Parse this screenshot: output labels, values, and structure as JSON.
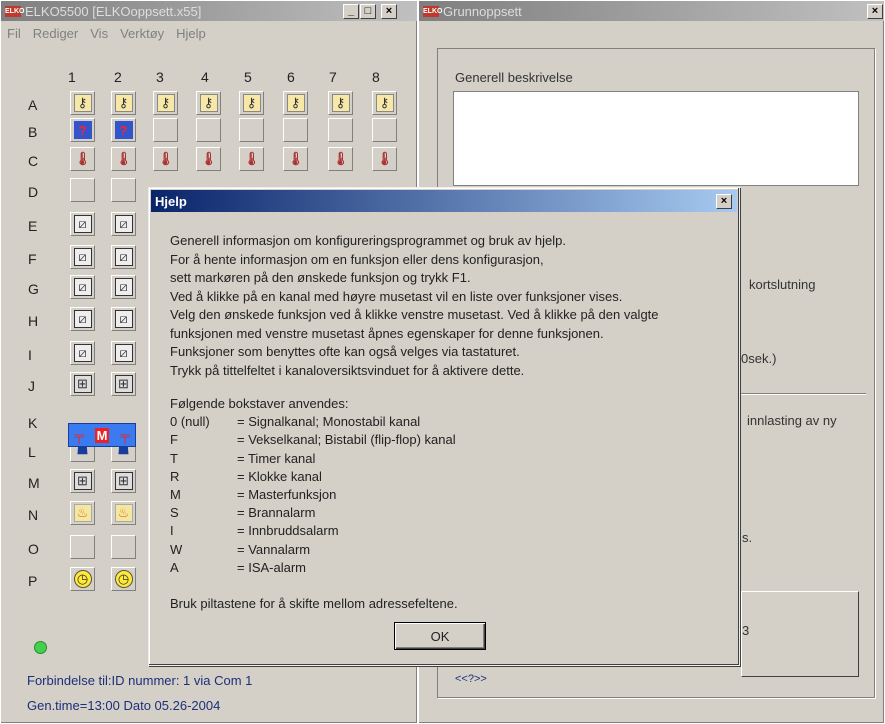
{
  "left_window": {
    "title": "ELKO5500 [ELKOoppsett.x55]",
    "menu": [
      "Fil",
      "Rediger",
      "Vis",
      "Verktøy",
      "Hjelp"
    ],
    "columns": [
      "1",
      "2",
      "3",
      "4",
      "5",
      "6",
      "7",
      "8"
    ],
    "rows": [
      "A",
      "B",
      "C",
      "D",
      "E",
      "F",
      "G",
      "H",
      "I",
      "J",
      "K",
      "L",
      "M",
      "N",
      "O",
      "P"
    ],
    "status_line1": "Forbindelse til:ID nummer:  1  via Com  1",
    "status_line2": "Gen.time=13:00  Dato  05.26-2004"
  },
  "right_window": {
    "title": "Grunnoppsett",
    "group_label": "Generell beskrivelse",
    "frag_kortslutning": "kortslutning",
    "frag_sek": "0sek.)",
    "frag_innlasting": "innlasting av ny",
    "frag_s": "s.",
    "frag_3": "3",
    "frag_nav": "<<?>>"
  },
  "dialog": {
    "title": "Hjelp",
    "close": "×",
    "lines": [
      "Generell informasjon om konfigureringsprogrammet og bruk av hjelp.",
      "For å hente informasjon om en funksjon eller dens konfigurasjon,",
      "sett markøren på den ønskede funksjon og trykk F1.",
      "Ved å klikke på en kanal med høyre musetast vil en liste over funksjoner vises.",
      "Velg den ønskede funksjon ved å klikke venstre musetast. Ved å klikke på den valgte",
      "funksjonen med venstre musetast åpnes egenskaper for denne funksjonen.",
      "Funksjoner som benyttes ofte kan også velges via tastaturet.",
      "Trykk på tittelfeltet i kanaloversiktsvinduet for å aktivere dette."
    ],
    "legend_title": "Følgende bokstaver anvendes:",
    "legend": [
      {
        "k": "0 (null)",
        "v": "= Signalkanal; Monostabil kanal"
      },
      {
        "k": "F",
        "v": "= Vekselkanal; Bistabil (flip-flop) kanal"
      },
      {
        "k": "T",
        "v": "= Timer kanal"
      },
      {
        "k": "R",
        "v": "= Klokke kanal"
      },
      {
        "k": "M",
        "v": "= Masterfunksjon"
      },
      {
        "k": "S",
        "v": "= Brannalarm"
      },
      {
        "k": "I",
        "v": "= Innbruddsalarm"
      },
      {
        "k": "W",
        "v": "= Vannalarm"
      },
      {
        "k": "A",
        "v": "= ISA-alarm"
      }
    ],
    "footer": "Bruk piltastene for å skifte mellom adressefeltene.",
    "ok_label": "OK"
  },
  "colors": {
    "dialog_title": "#0a246a",
    "inactive_title": "#808080",
    "led": "#42d14b"
  }
}
